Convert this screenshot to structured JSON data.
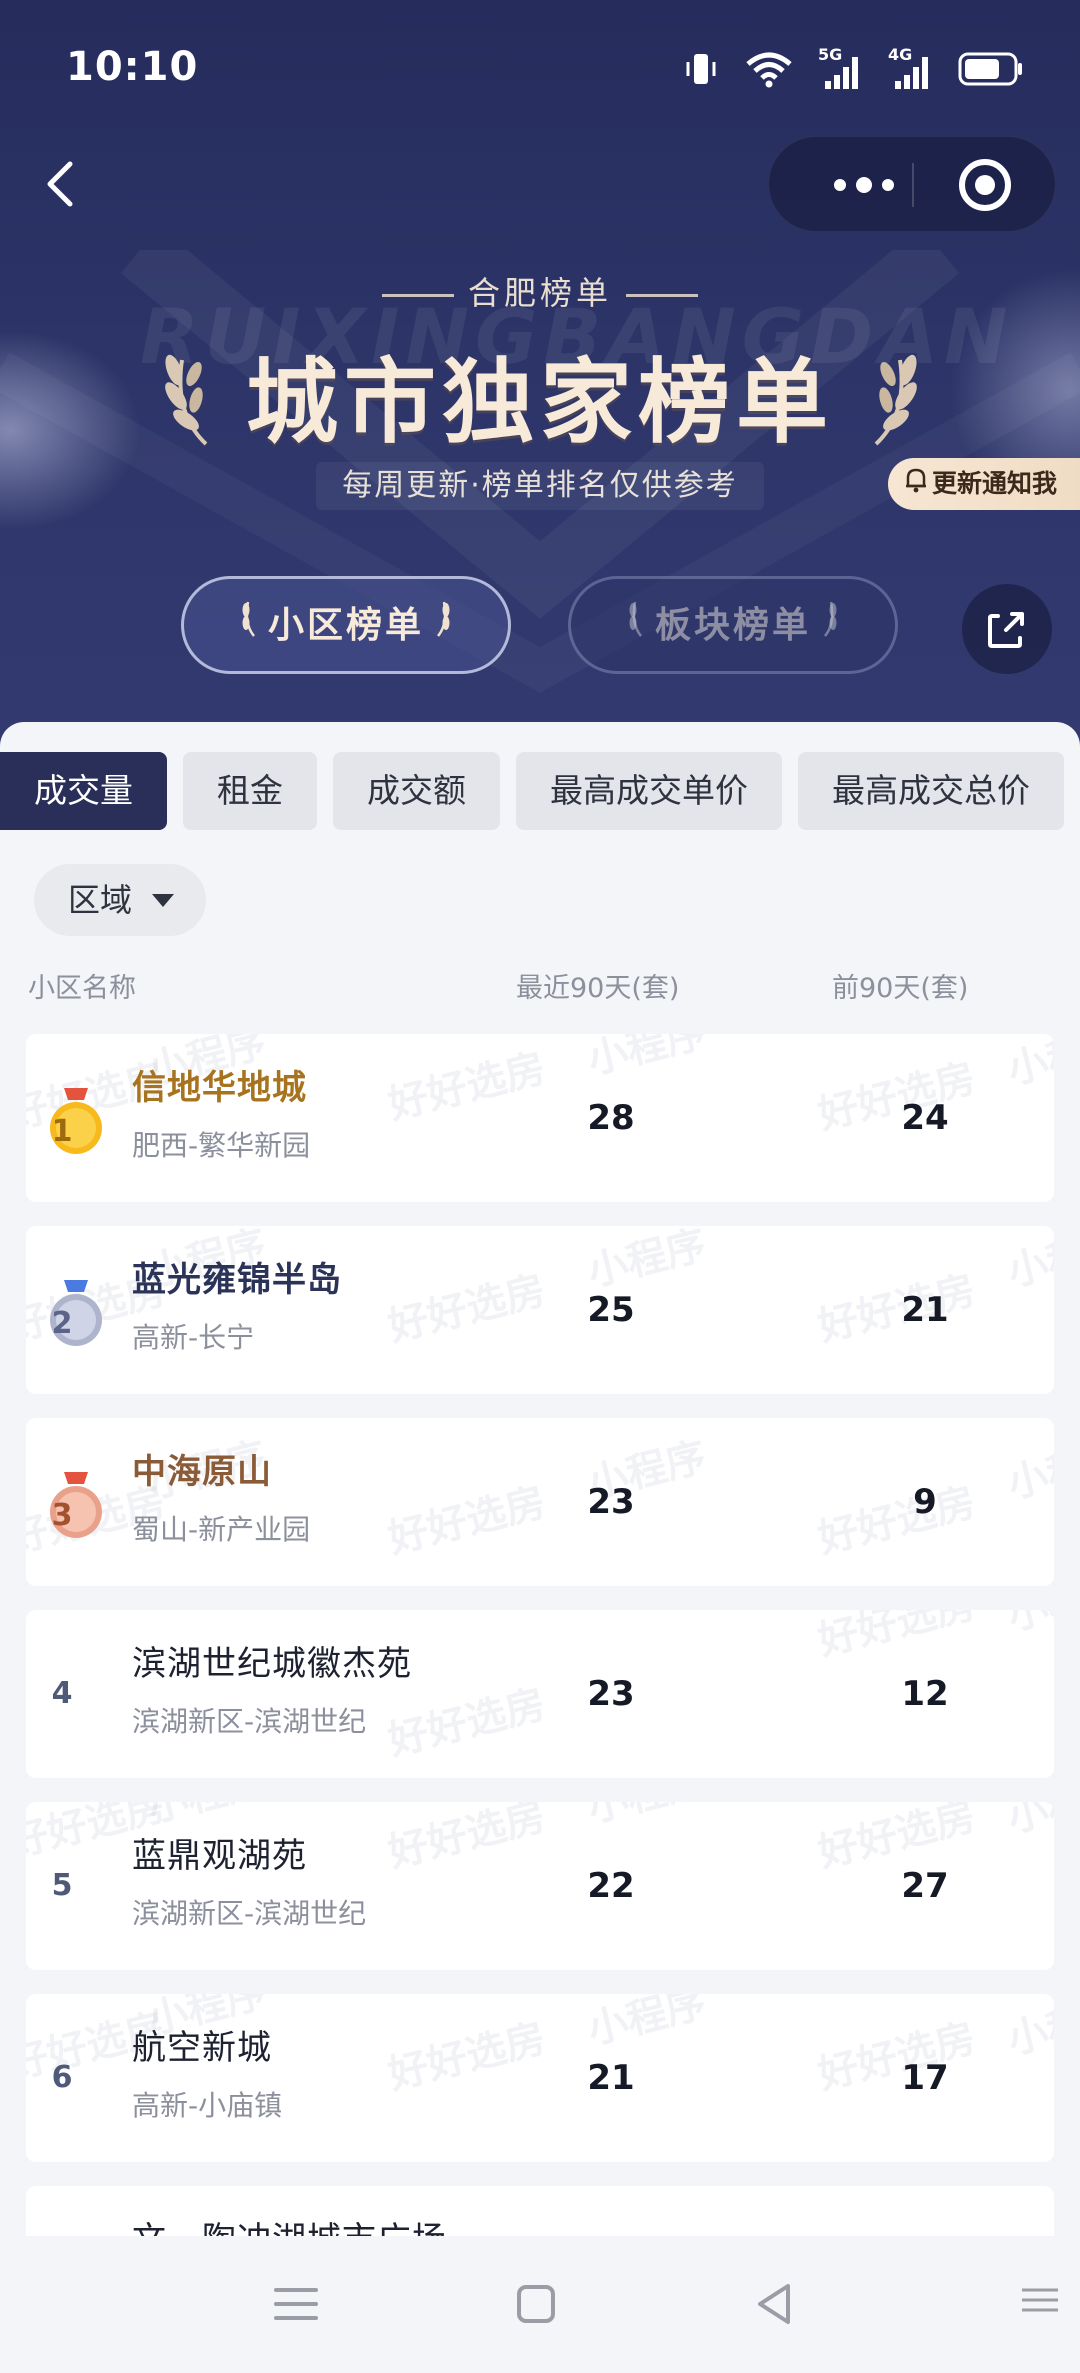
{
  "status_bar": {
    "time": "10:10",
    "net1": "5G",
    "net2": "4G"
  },
  "header": {
    "subtitle": "合肥榜单",
    "title": "城市独家榜单",
    "watermark": "RUIXINGBANGDAN",
    "description": "每周更新·榜单排名仅供参考",
    "notify_label": "更新通知我",
    "rank_tabs": [
      {
        "label": "小区榜单",
        "active": true
      },
      {
        "label": "板块榜单",
        "active": false
      }
    ]
  },
  "category_tabs": [
    {
      "label": "成交量",
      "active": true
    },
    {
      "label": "租金",
      "active": false
    },
    {
      "label": "成交额",
      "active": false
    },
    {
      "label": "最高成交单价",
      "active": false
    },
    {
      "label": "最高成交总价",
      "active": false
    }
  ],
  "filter": {
    "label": "区域"
  },
  "columns": {
    "name": "小区名称",
    "recent": "最近90天(套)",
    "previous": "前90天(套)"
  },
  "watermark_text": {
    "brand": "好好选房",
    "type": "小程序"
  },
  "rows": [
    {
      "rank": "1",
      "name": "信地华地城",
      "area": "肥西-繁华新园",
      "recent": "28",
      "previous": "24",
      "medal": "gold"
    },
    {
      "rank": "2",
      "name": "蓝光雍锦半岛",
      "area": "高新-长宁",
      "recent": "25",
      "previous": "21",
      "medal": "silver"
    },
    {
      "rank": "3",
      "name": "中海原山",
      "area": "蜀山-新产业园",
      "recent": "23",
      "previous": "9",
      "medal": "bronze"
    },
    {
      "rank": "4",
      "name": "滨湖世纪城徽杰苑",
      "area": "滨湖新区-滨湖世纪",
      "recent": "23",
      "previous": "12"
    },
    {
      "rank": "5",
      "name": "蓝鼎观湖苑",
      "area": "滨湖新区-滨湖世纪",
      "recent": "22",
      "previous": "27"
    },
    {
      "rank": "6",
      "name": "航空新城",
      "area": "高新-小庙镇",
      "recent": "21",
      "previous": "17"
    }
  ],
  "partial_row": {
    "name": "文一陶冲湖城市广场"
  },
  "colors": {
    "header_bg": "#2c3468",
    "accent_gold": "#a7731f",
    "active_tab": "#2a2f5a"
  }
}
